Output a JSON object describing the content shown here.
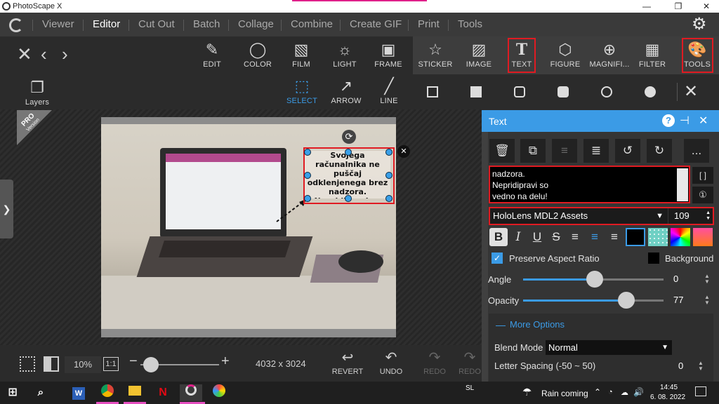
{
  "window": {
    "title": "PhotoScape X"
  },
  "menu": [
    {
      "label": "Viewer"
    },
    {
      "label": "Editor",
      "active": true
    },
    {
      "label": "Cut Out"
    },
    {
      "label": "Batch"
    },
    {
      "label": "Collage"
    },
    {
      "label": "Combine"
    },
    {
      "label": "Create GIF"
    },
    {
      "label": "Print"
    },
    {
      "label": "Tools"
    }
  ],
  "main_tools": [
    {
      "label": "EDIT",
      "icon": "edit-icon"
    },
    {
      "label": "COLOR",
      "icon": "color-icon"
    },
    {
      "label": "FILM",
      "icon": "film-icon"
    },
    {
      "label": "LIGHT",
      "icon": "light-icon"
    },
    {
      "label": "FRAME",
      "icon": "frame-icon"
    }
  ],
  "insert_tools": [
    {
      "label": "STICKER",
      "icon": "sticker-icon"
    },
    {
      "label": "IMAGE",
      "icon": "image-icon"
    },
    {
      "label": "TEXT",
      "icon": "text-icon",
      "highlighted": true
    },
    {
      "label": "FIGURE",
      "icon": "figure-icon"
    },
    {
      "label": "MAGNIFI...",
      "icon": "magnifier-icon"
    },
    {
      "label": "FILTER",
      "icon": "filter-icon"
    },
    {
      "label": "TOOLS",
      "icon": "tools-icon",
      "highlighted": true
    }
  ],
  "sub_tools": {
    "layers": "Layers",
    "select": "SELECT",
    "arrow": "ARROW",
    "line": "LINE"
  },
  "badge": {
    "line1": "PRO",
    "line2": "Version"
  },
  "canvas_text": "Svojega računalnika ne puščaj odklenjenega brez nadzora. Nepridipravi so vedno na delu!",
  "bottom": {
    "zoom": "10%",
    "ratio": "1:1",
    "dimensions": "4032 x 3024",
    "revert": "REVERT",
    "undo": "UNDO",
    "redo": "REDO",
    "redo2": "REDO"
  },
  "panel": {
    "title": "Text",
    "textarea_lines": [
      "nadzora.",
      "Nepridipravi so",
      "vedno na delu!"
    ],
    "font": "HoloLens MDL2 Assets",
    "font_size": "109",
    "more_button": "...",
    "bracket_button": "[ ]",
    "circled_one": "①",
    "preserve_aspect_ratio": "Preserve Aspect Ratio",
    "background": "Background",
    "angle_label": "Angle",
    "angle_value": "0",
    "opacity_label": "Opacity",
    "opacity_value": "77",
    "more_options": "More Options",
    "blend_mode_label": "Blend Mode",
    "blend_mode_value": "Normal",
    "letter_spacing_label": "Letter Spacing (-50 ~ 50)",
    "letter_spacing_value": "0"
  },
  "taskbar": {
    "language": "SL",
    "weather": "Rain coming",
    "time": "14:45",
    "date": "6. 08. 2022"
  },
  "colors": {
    "accent_blue": "#3b9be6",
    "highlight_red": "#e01b22",
    "panel_bg": "#353535"
  }
}
